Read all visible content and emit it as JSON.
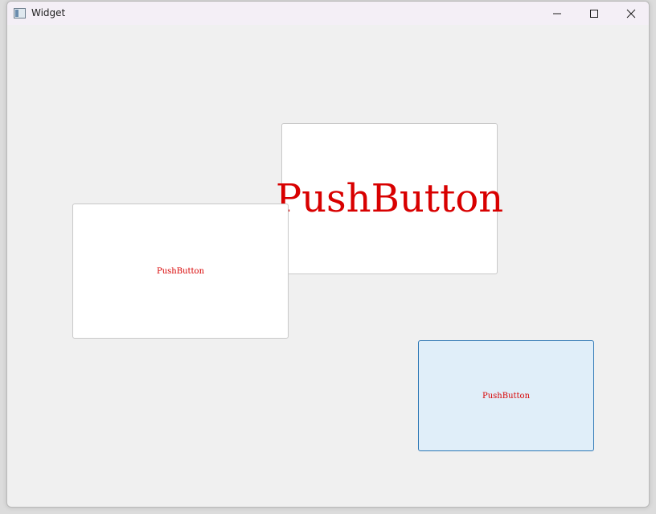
{
  "window": {
    "title": "Widget"
  },
  "buttons": [
    {
      "label": "PushButton",
      "state": "normal"
    },
    {
      "label": "PushButton",
      "state": "normal"
    },
    {
      "label": "PushButton",
      "state": "hover"
    }
  ],
  "colors": {
    "text": "#d80000",
    "hover_bg": "#e0eef9",
    "hover_border": "#2d77b5",
    "window_bg": "#f0f0f0"
  },
  "icons": {
    "app": "app-window-icon",
    "minimize": "minimize-icon",
    "maximize": "maximize-icon",
    "close": "close-icon"
  }
}
